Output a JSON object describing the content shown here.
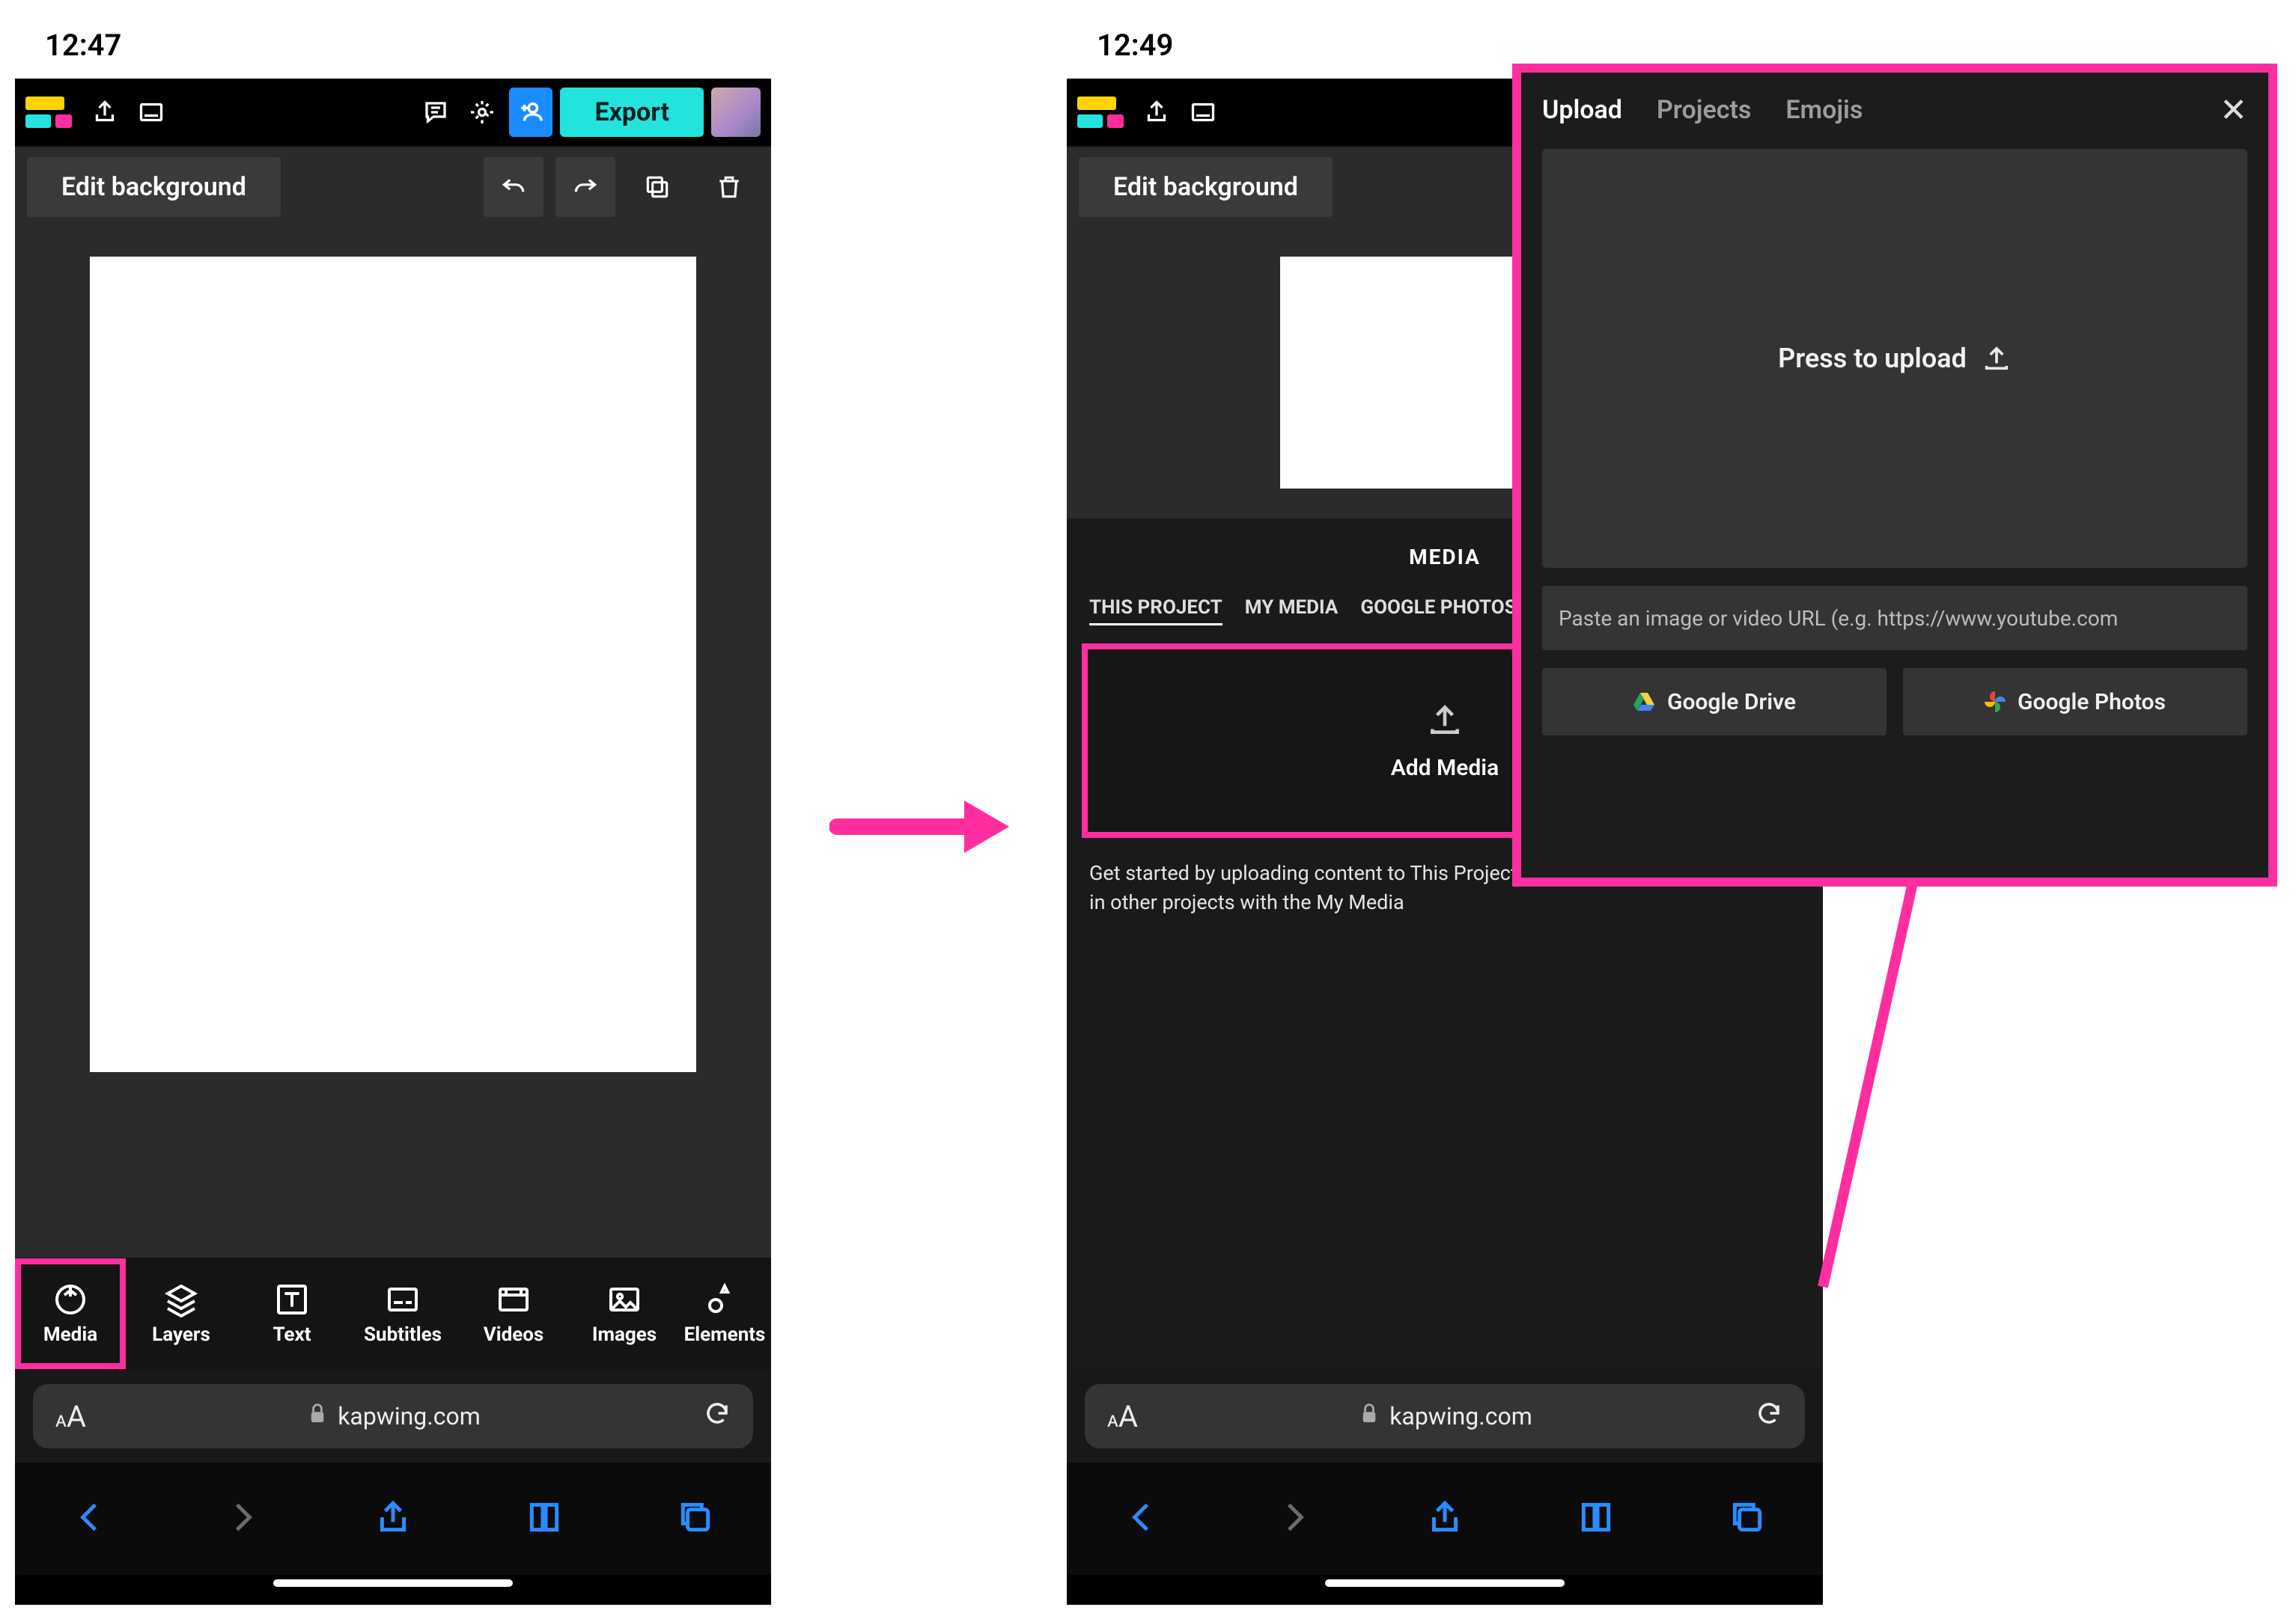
{
  "status": {
    "time1": "12:47",
    "time2": "12:49"
  },
  "toolbar": {
    "export_label": "Export"
  },
  "editbar": {
    "edit_bg": "Edit background"
  },
  "tooltabs": {
    "media": "Media",
    "layers": "Layers",
    "text": "Text",
    "subtitles": "Subtitles",
    "videos": "Videos",
    "images": "Images",
    "elements": "Elements"
  },
  "urlbar": {
    "domain": "kapwing.com"
  },
  "media_panel": {
    "title": "MEDIA",
    "tabs": {
      "this_project": "THIS PROJECT",
      "my_media": "MY MEDIA",
      "google_photos": "GOOGLE PHOTOS"
    },
    "add_media": "Add Media",
    "help": "Get started by uploading content to This Project. You can access content used in other projects with the My Media"
  },
  "popup": {
    "tabs": {
      "upload": "Upload",
      "projects": "Projects",
      "emojis": "Emojis"
    },
    "press_to_upload": "Press to upload",
    "url_placeholder": "Paste an image or video URL (e.g. https://www.youtube.com",
    "gdrive": "Google Drive",
    "gphotos": "Google Photos"
  }
}
